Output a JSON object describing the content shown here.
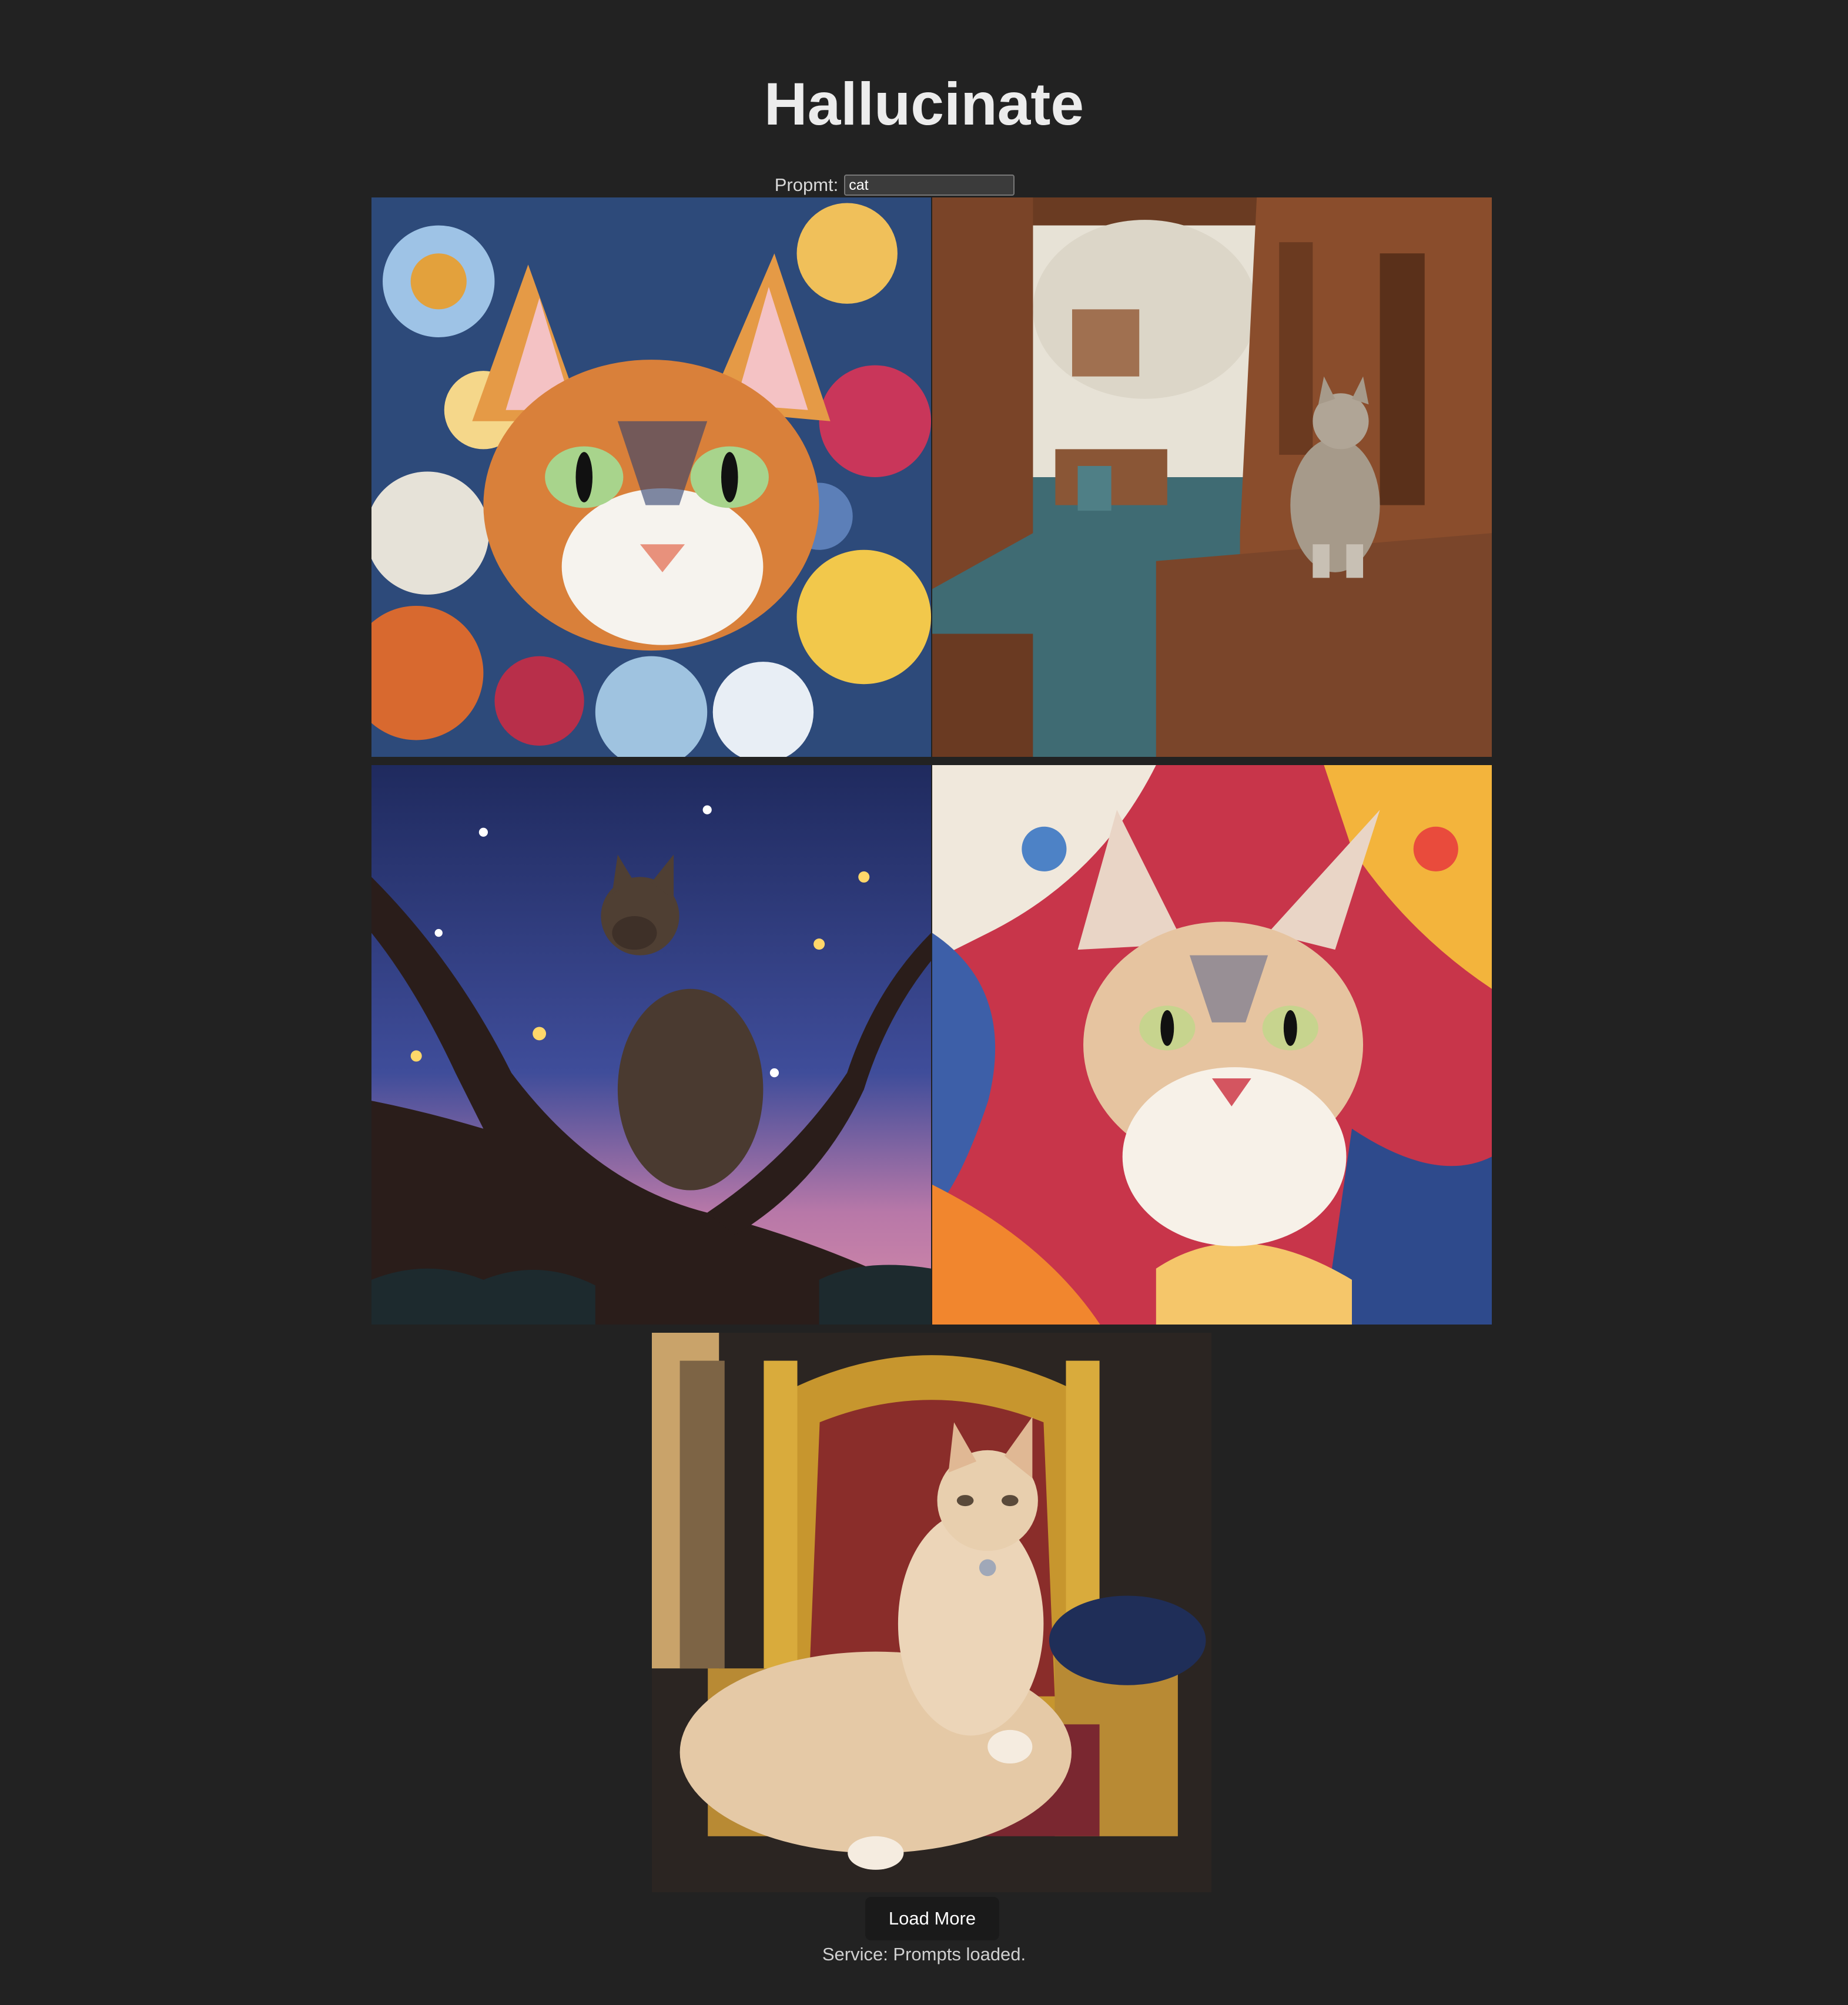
{
  "header": {
    "title": "Hallucinate"
  },
  "prompt": {
    "label": "Propmt:",
    "value": "cat"
  },
  "gallery": {
    "images": [
      {
        "name": "swirl-cat-painting"
      },
      {
        "name": "ruins-cat-painting"
      },
      {
        "name": "night-tree-cat-painting"
      },
      {
        "name": "abstract-cat-painting"
      },
      {
        "name": "throne-cat-painting"
      }
    ]
  },
  "actions": {
    "load_more_label": "Load More"
  },
  "status": {
    "text": "Service: Prompts loaded."
  }
}
